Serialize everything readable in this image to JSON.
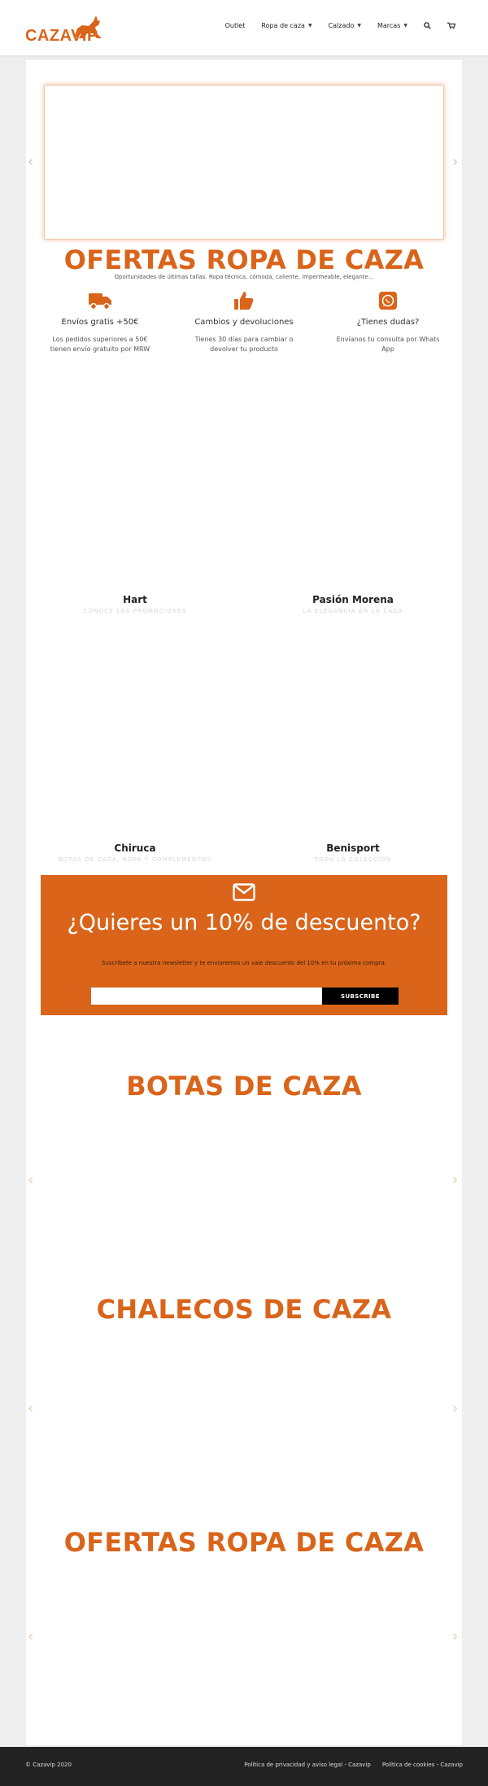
{
  "header": {
    "logo_text": "CAZAVIP",
    "nav": {
      "outlet": "Outlet",
      "ropa": "Ropa de caza",
      "calzado": "Calzado",
      "marcas": "Marcas"
    }
  },
  "hero": {
    "title": "OFERTAS ROPA DE CAZA",
    "subtitle": "Oportunidades de últimas tallas. Ropa técnica, cómoda, caliente, impermeable, elegante..."
  },
  "features": [
    {
      "title": "Envíos gratis +50€",
      "text": "Los pedidos superiores a 50€ tienen envío gratuito por MRW",
      "icon": "truck-icon"
    },
    {
      "title": "Cambios y devoluciones",
      "text": "Tienes 30 días para cambiar o devolver tu producto",
      "icon": "thumbs-up-icon"
    },
    {
      "title": "¿Tienes dudas?",
      "text": "Envíanos tu consulta por Whats App",
      "icon": "whatsapp-icon"
    }
  ],
  "brands": [
    {
      "name": "Hart",
      "sub": "CONOCE LAS PROMOCIONES"
    },
    {
      "name": "Pasión Morena",
      "sub": "LA ELEGANCIA EN LA CAZA"
    },
    {
      "name": "Chiruca",
      "sub": "BOTAS DE CAZA, ROPA Y COMPLEMENTOS"
    },
    {
      "name": "Benisport",
      "sub": "TODA LA COLECCIÓN"
    }
  ],
  "newsletter": {
    "title": "¿Quieres un 10% de descuento?",
    "text": "Suscríbete a nuestra newsletter y te enviaremos un vale descuento del 10% en tu próxima compra.",
    "input_placeholder": "",
    "button": "SUBSCRIBE"
  },
  "sections": {
    "botas": "BOTAS DE CAZA",
    "chalecos": "CHALECOS DE CAZA",
    "ofertas": "OFERTAS ROPA DE CAZA"
  },
  "arrows": {
    "prev": "‹",
    "next": "›"
  },
  "footer": {
    "copyright": "© Cazavip 2020",
    "privacy": "Política de privacidad y aviso legal - Cazavip",
    "cookies": "Política de cookies - Cazavip"
  },
  "colors": {
    "accent": "#d9641a",
    "footer_bg": "#222222",
    "page_bg": "#efefef"
  }
}
